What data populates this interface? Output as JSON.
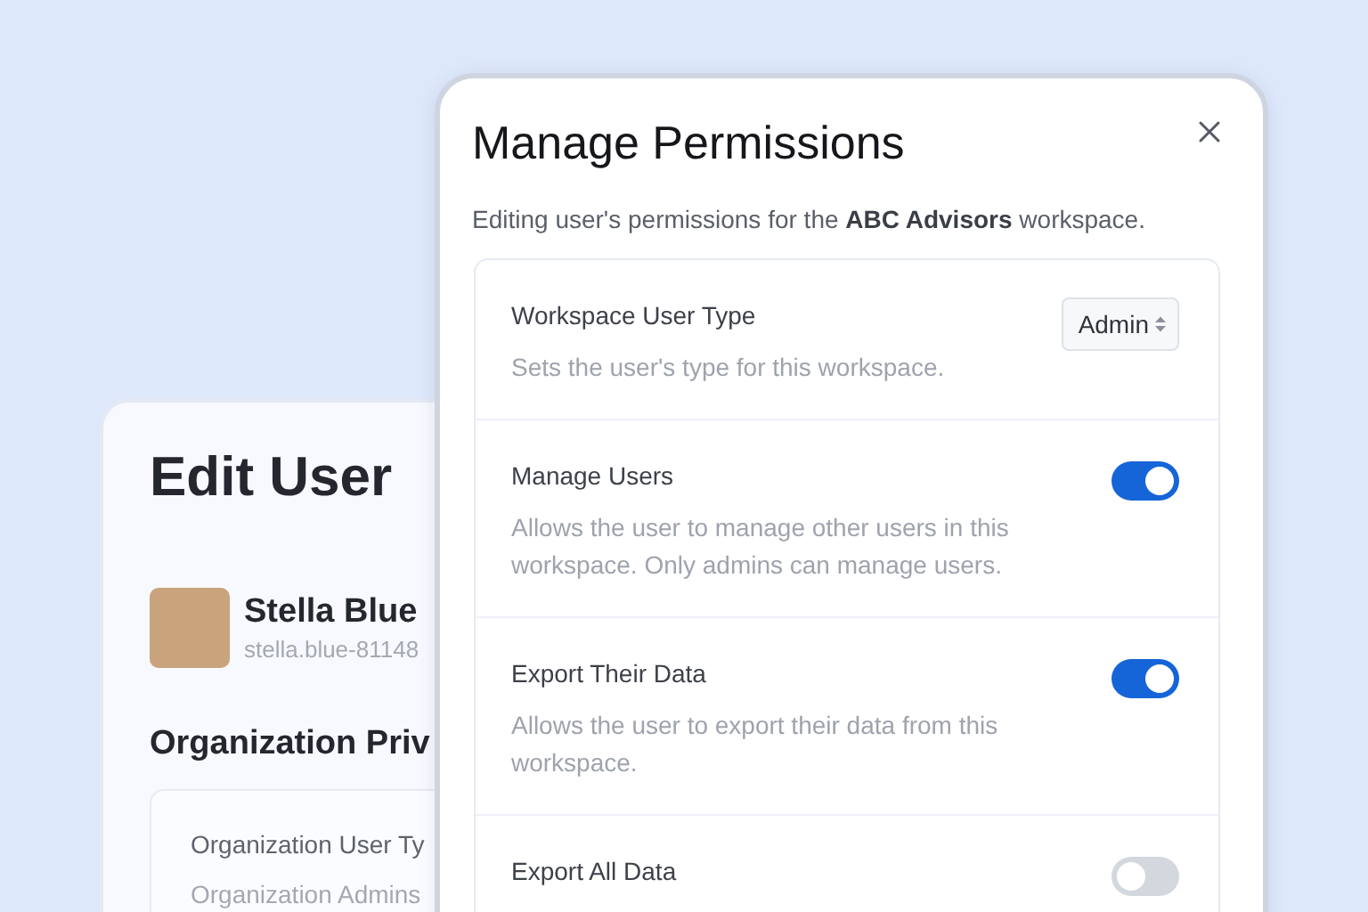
{
  "edit_user": {
    "title": "Edit User",
    "user": {
      "name": "Stella Blue",
      "email": "stella.blue-81148"
    },
    "section_title": "Organization Priv",
    "field": {
      "label": "Organization User Ty",
      "description": "Organization Admins"
    }
  },
  "modal": {
    "title": "Manage Permissions",
    "description": "Editing user's permissions for the **ABC Advisors** workspace.",
    "settings": [
      {
        "kind": "select",
        "label": "Workspace User Type",
        "description": "Sets the user's type for this workspace.",
        "value": "Admin"
      },
      {
        "kind": "toggle",
        "label": "Manage Users",
        "description": "Allows the user to manage other users in this workspace. Only admins can manage users.",
        "on": true
      },
      {
        "kind": "toggle",
        "label": "Export Their Data",
        "description": "Allows the user to export their data from this workspace.",
        "on": true
      },
      {
        "kind": "toggle",
        "label": "Export All Data",
        "on": false
      }
    ]
  }
}
